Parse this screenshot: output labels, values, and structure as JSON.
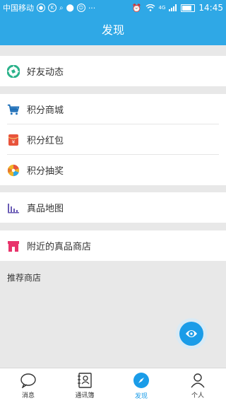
{
  "status_bar": {
    "carrier": "中国移动",
    "network": "4G",
    "time": "14:45"
  },
  "header": {
    "title": "发现"
  },
  "groups": [
    {
      "items": [
        {
          "label": "好友动态",
          "icon": "aperture-icon"
        }
      ]
    },
    {
      "items": [
        {
          "label": "积分商城",
          "icon": "cart-icon"
        },
        {
          "label": "积分红包",
          "icon": "red-envelope-icon"
        },
        {
          "label": "积分抽奖",
          "icon": "lottery-wheel-icon"
        }
      ]
    },
    {
      "items": [
        {
          "label": "真品地图",
          "icon": "bar-chart-icon"
        }
      ]
    },
    {
      "items": [
        {
          "label": "附近的真品商店",
          "icon": "store-icon"
        }
      ]
    }
  ],
  "recommend": {
    "label": "推荐商店"
  },
  "tabs": [
    {
      "label": "消息",
      "icon": "chat-bubble-icon",
      "active": false
    },
    {
      "label": "通讯簿",
      "icon": "contacts-book-icon",
      "active": false
    },
    {
      "label": "发现",
      "icon": "compass-icon",
      "active": true
    },
    {
      "label": "个人",
      "icon": "person-icon",
      "active": false
    }
  ],
  "colors": {
    "accent": "#2fa8e6",
    "active_tab": "#1a9ce8",
    "cart": "#1e6fb8",
    "red_envelope": "#e8543c",
    "lottery": "#f0b428",
    "map_chart": "#6a5bb5",
    "store": "#e8336b",
    "friends": "#2bb28a"
  }
}
